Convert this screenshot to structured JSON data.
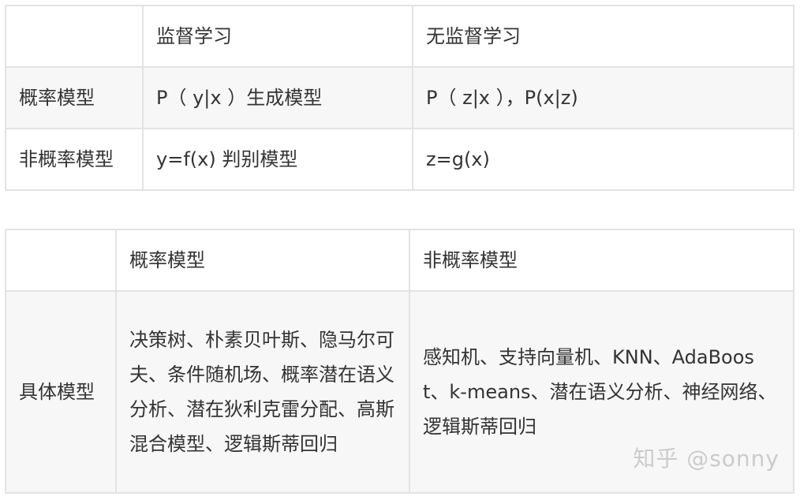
{
  "table1": {
    "header": [
      "",
      "监督学习",
      "无监督学习"
    ],
    "rows": [
      [
        "概率模型",
        "P（ y|x ）生成模型",
        "P（ z|x ），P(x|z)"
      ],
      [
        "非概率模型",
        "y=f(x) 判别模型",
        "z=g(x)"
      ]
    ]
  },
  "table2": {
    "header": [
      "",
      "概率模型",
      "非概率模型"
    ],
    "rows": [
      [
        "具体模型",
        "决策树、朴素贝叶斯、隐马尔可夫、条件随机场、概率潜在语义分析、潜在狄利克雷分配、高斯混合模型、逻辑斯蒂回归",
        "感知机、支持向量机、KNN、AdaBoost、k-means、潜在语义分析、神经网络、逻辑斯蒂回归"
      ]
    ]
  },
  "watermark": "知乎 @sonny"
}
